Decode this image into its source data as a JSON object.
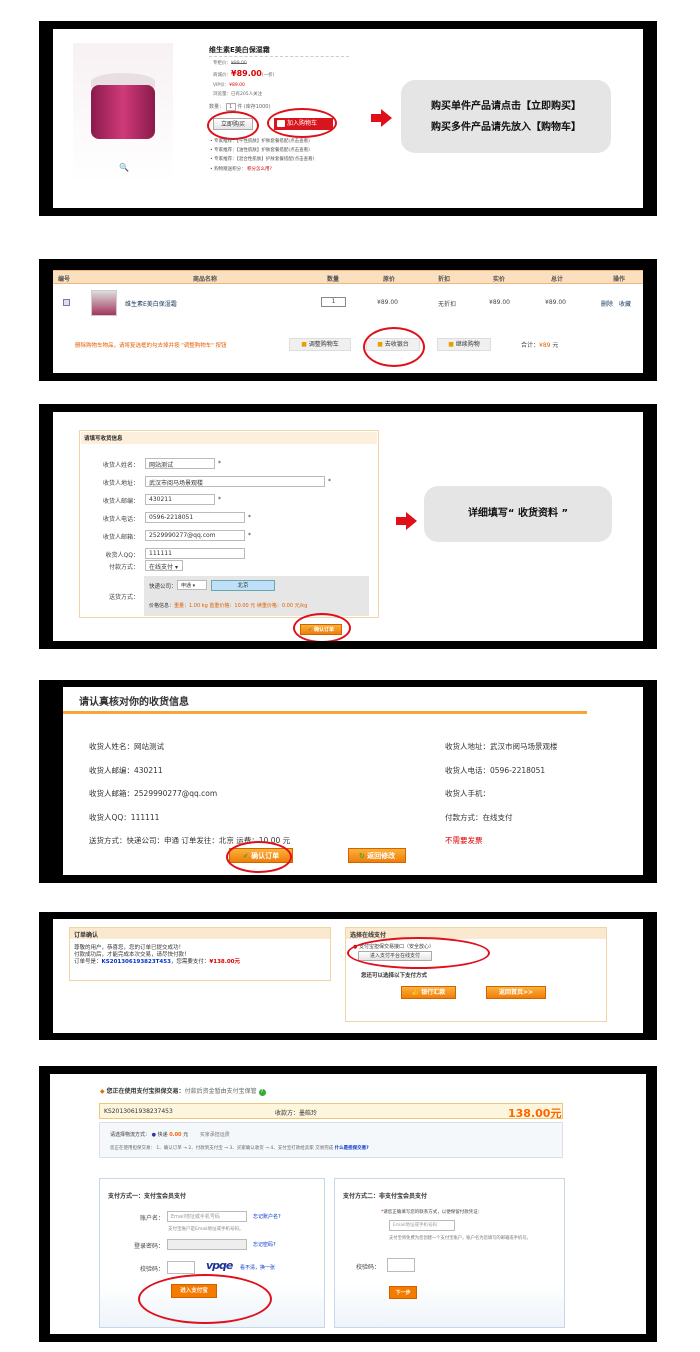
{
  "s1": {
    "title": "维生素E美白保湿霜",
    "rows": [
      {
        "label": "专柜价：",
        "value": "¥89.00"
      },
      {
        "label": "商城价：",
        "value": "¥89.00"
      },
      {
        "label": "VIP价：",
        "value": "¥89.00"
      },
      {
        "label": "浏览量：",
        "value": "已有205人关注"
      }
    ],
    "price_suffix": "(一折)",
    "qty_label": "数量：",
    "qty_value": "1",
    "stock": "件 (库存1000)",
    "buy_now": "立即购买",
    "add_cart": "加入购物车",
    "recs": [
      "• 专家推荐：【干性肌肤】护肤套餐搭配(点击查看)",
      "• 专家推荐：【油性肌肤】护肤套餐搭配(点击查看)",
      "• 专家推荐：【混合性肌肤】护肤套餐搭配(点击查看)"
    ],
    "points_label": "• 购物赠送积分：",
    "points_link": "积分怎么用?",
    "zoom": "🔍",
    "note1": "购买单件产品请点击【立即购买】",
    "note2": "购买多件产品请先放入【购物车】"
  },
  "s2": {
    "headers": [
      "编号",
      "商品名称",
      "数量",
      "原价",
      "折扣",
      "实价",
      "总计",
      "操作"
    ],
    "row": {
      "name": "维生素E美白保湿霜",
      "qty": "1",
      "price": "¥89.00",
      "discount": "无折扣",
      "real": "¥89.00",
      "total": "¥89.00",
      "ops": [
        "删除",
        "收藏"
      ]
    },
    "hint": "删除购物车物品，请将复选框的勾去掉并按 \"调整购物车\" 按钮",
    "btn_adjust": "调整购物车",
    "btn_checkout": "去收银台",
    "btn_continue": "继续购物",
    "sum_label": "合计：",
    "sum_value": "¥89",
    "sum_unit": "元"
  },
  "s3": {
    "title": "请填写收货信息",
    "fields": [
      {
        "label": "收货人姓名：",
        "value": "网站测试"
      },
      {
        "label": "收货人地址：",
        "value": "武汉市阅马场景观楼"
      },
      {
        "label": "收货人邮编：",
        "value": "430211"
      },
      {
        "label": "收货人电话：",
        "value": "0596-2218051"
      },
      {
        "label": "收货人邮箱：",
        "value": "2529990277@qq.com"
      },
      {
        "label": "收货人QQ：",
        "value": "111111"
      }
    ],
    "pay_label": "付款方式：",
    "pay_value": "在线支付",
    "ship_label": "送货方式：",
    "express_label": "快递公司：",
    "express_value": "申通",
    "city": "北京",
    "price_info_label": "价格信息：",
    "price_info": "重量：1.00 kg 首重价格：10.00 元 续重价格：0.00 元/kg",
    "confirm": "确认订单",
    "note": "详细填写“ 收货资料 ”"
  },
  "s4": {
    "title": "请认真核对你的收货信息",
    "left": [
      "收货人姓名：网站测试",
      "收货人邮编：430211",
      "收货人邮箱：2529990277@qq.com",
      "收货人QQ：111111",
      "送货方式：快递公司：申通 订单发往：北京 运费：10.00 元"
    ],
    "right": [
      "收货人地址：武汉市阅马场景观楼",
      "收货人电话：0596-2218051",
      "收货人手机：",
      "付款方式：在线支付",
      "不需要发票"
    ],
    "confirm": "确认订单",
    "back": "返回修改"
  },
  "s5": {
    "left_title": "订单确认",
    "line1": "尊敬的用户，恭喜您，您的订单已提交成功！",
    "line2": "付款成功后，才能完成本次交易，请尽快付款！",
    "order_label": "订单号是：",
    "order_no": "KS201306193823T453",
    "pay_label": "，您需要支付：",
    "pay_value": "¥138.00元",
    "right_title": "选择在线支付",
    "alipay_opt": "支付宝担保交易接口（安全放心）",
    "alipay_btn": "进入支付平台在线支付",
    "other": "您还可以选择以下支付方式",
    "bank": "银行汇款",
    "home": "返回首页>>"
  },
  "s6": {
    "head": "您正在使用支付宝担保交易：",
    "head_sub": "付款后资金暂由支付宝保管",
    "order_no": "KS2013061938237453",
    "payee": "收款方：",
    "payee_name": "墨皓玲",
    "amount": "138.00元",
    "logistics_label": "请选择物流方式：",
    "logistics": "快递",
    "logistics_fee": "0.00",
    "logistics_unit": "元",
    "buyer_fee": "买家承担运费",
    "flow": "您正在使用担保交易：  1、确认订单 → 2、付款到支付宝 → 3、买家确认收货 → 4、支付宝打款给卖家 交易完成",
    "flow_link": "什么是担保交易?",
    "m1_title": "支付方式一：支付宝会员支付",
    "acc_label": "账户名：",
    "acc_ph": "Email地址或手机号码",
    "acc_link": "忘记账户名?",
    "acc_hint": "支付宝账户是Email地址或手机号码。",
    "pwd_label": "登录密码：",
    "pwd_link": "忘记密码?",
    "code_label": "校验码：",
    "captcha": "vpqe",
    "captcha_link": "看不清，换一张",
    "login_btn": "进入支付宝",
    "m2_title": "支付方式二：非支付宝会员支付",
    "m2_hint": "请您正确填写您的联系方式，以便保留付款凭证：",
    "m2_ph": "Email地址或手机号码",
    "m2_hint2": "支付宝将免费为您创建一个支付宝账户，账户名为您填写的邮箱或手机号。",
    "m2_code": "校验码：",
    "next": "下一步"
  }
}
